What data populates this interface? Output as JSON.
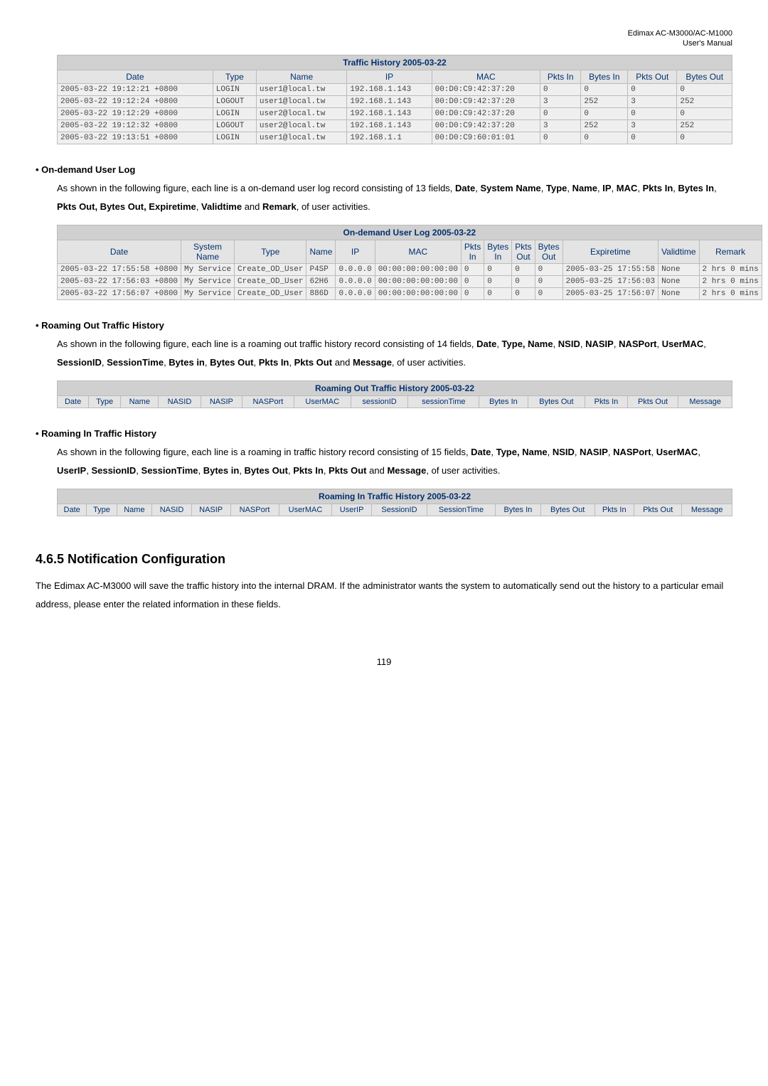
{
  "page_header": {
    "line1": "Edimax AC-M3000/AC-M1000",
    "line2": "User's Manual"
  },
  "traffic_history": {
    "caption": "Traffic History 2005-03-22",
    "headers": [
      "Date",
      "Type",
      "Name",
      "IP",
      "MAC",
      "Pkts In",
      "Bytes In",
      "Pkts Out",
      "Bytes Out"
    ],
    "rows": [
      [
        "2005-03-22 19:12:21 +0800",
        "LOGIN",
        "user1@local.tw",
        "192.168.1.143",
        "00:D0:C9:42:37:20",
        "0",
        "0",
        "0",
        "0"
      ],
      [
        "2005-03-22 19:12:24 +0800",
        "LOGOUT",
        "user1@local.tw",
        "192.168.1.143",
        "00:D0:C9:42:37:20",
        "3",
        "252",
        "3",
        "252"
      ],
      [
        "2005-03-22 19:12:29 +0800",
        "LOGIN",
        "user2@local.tw",
        "192.168.1.143",
        "00:D0:C9:42:37:20",
        "0",
        "0",
        "0",
        "0"
      ],
      [
        "2005-03-22 19:12:32 +0800",
        "LOGOUT",
        "user2@local.tw",
        "192.168.1.143",
        "00:D0:C9:42:37:20",
        "3",
        "252",
        "3",
        "252"
      ],
      [
        "2005-03-22 19:13:51 +0800",
        "LOGIN",
        "user1@local.tw",
        "192.168.1.1",
        "00:D0:C9:60:01:01",
        "0",
        "0",
        "0",
        "0"
      ]
    ]
  },
  "on_demand": {
    "title": "On-demand User Log",
    "desc_p1": "As shown in the following figure, each line is a on-demand user log record consisting of 13 fields, ",
    "desc_bold1": "Date",
    "desc_p2": ", ",
    "desc_bold2": "System Name",
    "desc_p3": ", ",
    "desc_bold3": "Type",
    "desc_p4": ", ",
    "desc_bold4": "Name",
    "desc_p5": ", ",
    "desc_bold5": "IP",
    "desc_p6": ", ",
    "desc_bold6": "MAC",
    "desc_p7": ", ",
    "desc_bold7": "Pkts In",
    "desc_p8": ", ",
    "desc_bold8": "Bytes In",
    "desc_p9": ", ",
    "desc_bold9": "Pkts Out, Bytes Out, Expiretime",
    "desc_p10": ", ",
    "desc_bold10": "Validtime",
    "desc_p11": " and ",
    "desc_bold11": "Remark",
    "desc_p12": ", of user activities.",
    "caption": "On-demand User Log 2005-03-22",
    "headers": [
      "Date",
      "System Name",
      "Type",
      "Name",
      "IP",
      "MAC",
      "Pkts In",
      "Bytes In",
      "Pkts Out",
      "Bytes Out",
      "Expiretime",
      "Validtime",
      "Remark"
    ],
    "rows": [
      [
        "2005-03-22 17:55:58 +0800",
        "My Service",
        "Create_OD_User",
        "P4SP",
        "0.0.0.0",
        "00:00:00:00:00:00",
        "0",
        "0",
        "0",
        "0",
        "2005-03-25 17:55:58",
        "None",
        "2 hrs 0 mins"
      ],
      [
        "2005-03-22 17:56:03 +0800",
        "My Service",
        "Create_OD_User",
        "62H6",
        "0.0.0.0",
        "00:00:00:00:00:00",
        "0",
        "0",
        "0",
        "0",
        "2005-03-25 17:56:03",
        "None",
        "2 hrs 0 mins"
      ],
      [
        "2005-03-22 17:56:07 +0800",
        "My Service",
        "Create_OD_User",
        "886D",
        "0.0.0.0",
        "00:00:00:00:00:00",
        "0",
        "0",
        "0",
        "0",
        "2005-03-25 17:56:07",
        "None",
        "2 hrs 0 mins"
      ]
    ]
  },
  "roaming_out": {
    "title": "Roaming Out Traffic History",
    "desc_p1": "As shown in the following figure, each line is a roaming out traffic history record consisting of 14 fields, ",
    "desc_bold1": "Date",
    "desc_p2": ", ",
    "desc_bold2": "Type, Name",
    "desc_p3": ", ",
    "desc_bold3": "NSID",
    "desc_p4": ", ",
    "desc_bold4": "NASIP",
    "desc_p5": ", ",
    "desc_bold5": "NASPort",
    "desc_p6": ", ",
    "desc_bold6": "UserMAC",
    "desc_p7": ", ",
    "desc_bold7": "SessionID",
    "desc_p8": ", ",
    "desc_bold8": "SessionTime",
    "desc_p9": ", ",
    "desc_bold9": "Bytes in",
    "desc_p10": ", ",
    "desc_bold10": "Bytes Out",
    "desc_p11": ", ",
    "desc_bold11": "Pkts In",
    "desc_p12": ", ",
    "desc_bold12": "Pkts Out",
    "desc_p13": " and ",
    "desc_bold13": "Message",
    "desc_p14": ", of user activities.",
    "caption": "Roaming Out Traffic History 2005-03-22",
    "headers": [
      "Date",
      "Type",
      "Name",
      "NASID",
      "NASIP",
      "NASPort",
      "UserMAC",
      "sessionID",
      "sessionTime",
      "Bytes In",
      "Bytes Out",
      "Pkts In",
      "Pkts Out",
      "Message"
    ]
  },
  "roaming_in": {
    "title": "Roaming In Traffic History",
    "desc_p1": "As shown in the following figure, each line is a roaming in traffic history record consisting of 15 fields, ",
    "desc_bold1": "Date",
    "desc_p2": ", ",
    "desc_bold2": "Type, Name",
    "desc_p3": ", ",
    "desc_bold3": "NSID",
    "desc_p4": ", ",
    "desc_bold4": "NASIP",
    "desc_p5": ", ",
    "desc_bold5": "NASPort",
    "desc_p6": ", ",
    "desc_bold6": "UserMAC",
    "desc_p7": ", ",
    "desc_bold7": "UserIP",
    "desc_p8": ", ",
    "desc_bold8": "SessionID",
    "desc_p9": ", ",
    "desc_bold9": "SessionTime",
    "desc_p10": ", ",
    "desc_bold10": "Bytes in",
    "desc_p11": ", ",
    "desc_bold11": "Bytes Out",
    "desc_p12": ", ",
    "desc_bold12": "Pkts In",
    "desc_p13": ", ",
    "desc_bold13": "Pkts Out",
    "desc_p14": " and ",
    "desc_bold14": "Message",
    "desc_p15": ", of user activities.",
    "caption": "Roaming In Traffic History 2005-03-22",
    "headers": [
      "Date",
      "Type",
      "Name",
      "NASID",
      "NASIP",
      "NASPort",
      "UserMAC",
      "UserIP",
      "SessionID",
      "SessionTime",
      "Bytes In",
      "Bytes Out",
      "Pkts In",
      "Pkts Out",
      "Message"
    ]
  },
  "notification": {
    "heading": "4.6.5 Notification Configuration",
    "body": "The Edimax AC-M3000 will save the traffic history into the internal DRAM. If the administrator wants the system to automatically send out the history to a particular email address, please enter the related information in these fields."
  },
  "page_number": "119"
}
